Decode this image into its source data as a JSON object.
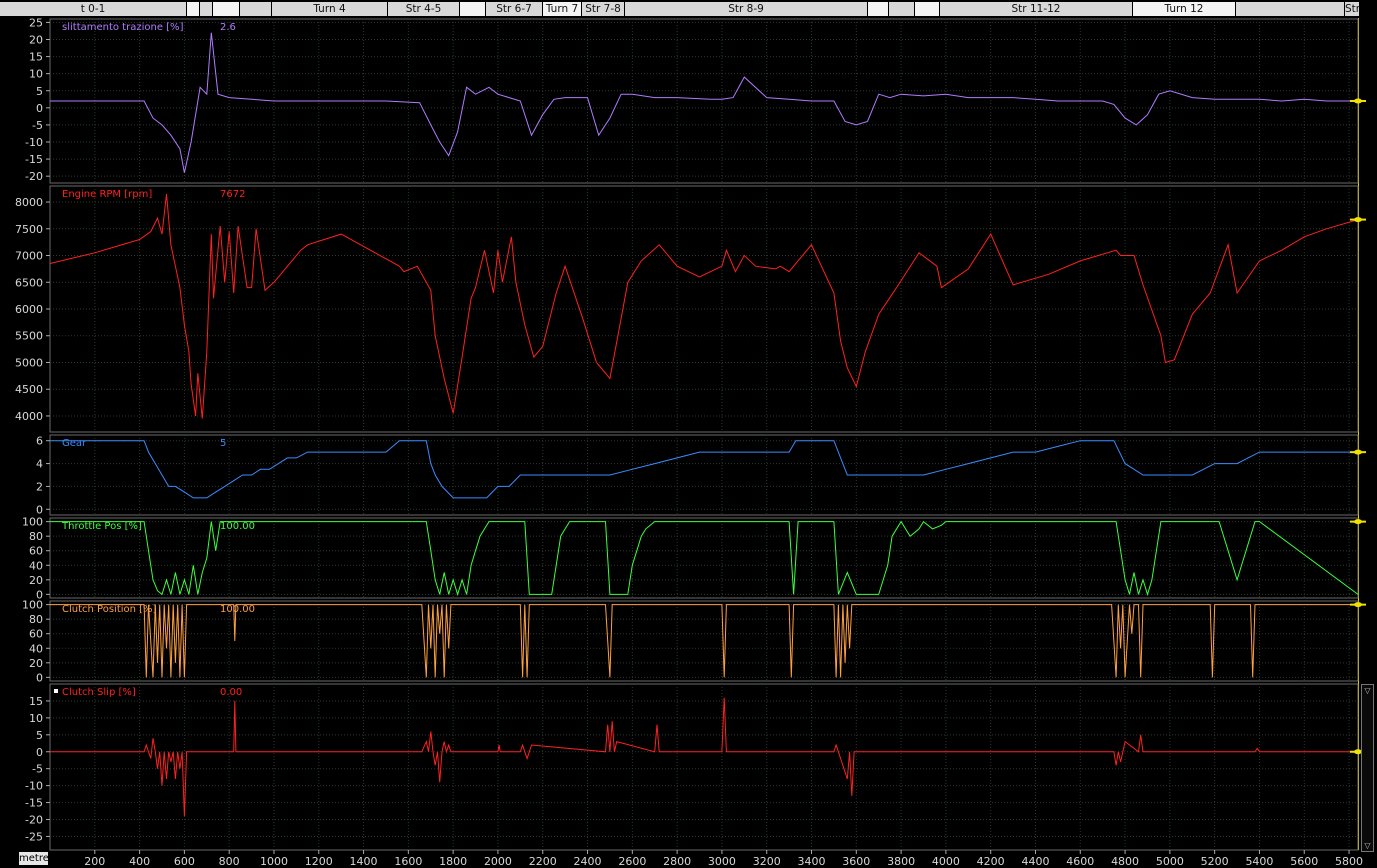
{
  "segments": [
    {
      "label": "t 0-1",
      "start": 0,
      "end": 187,
      "shade": "light"
    },
    {
      "label": "",
      "start": 187,
      "end": 200,
      "shade": "gap"
    },
    {
      "label": "",
      "start": 200,
      "end": 213,
      "shade": "light"
    },
    {
      "label": "",
      "start": 213,
      "end": 240,
      "shade": "gap"
    },
    {
      "label": "",
      "start": 240,
      "end": 272,
      "shade": "light"
    },
    {
      "label": "Turn 4",
      "start": 272,
      "end": 388,
      "shade": "light"
    },
    {
      "label": "Str 4-5",
      "start": 388,
      "end": 460,
      "shade": "light"
    },
    {
      "label": "",
      "start": 460,
      "end": 486,
      "shade": "gap"
    },
    {
      "label": "Str 6-7",
      "start": 486,
      "end": 543,
      "shade": "light"
    },
    {
      "label": "Turn 7",
      "start": 543,
      "end": 582,
      "shade": "gap"
    },
    {
      "label": "Str 7-8",
      "start": 582,
      "end": 625,
      "shade": "light"
    },
    {
      "label": "Str 8-9",
      "start": 625,
      "end": 868,
      "shade": "light"
    },
    {
      "label": "",
      "start": 868,
      "end": 889,
      "shade": "gap"
    },
    {
      "label": "",
      "start": 889,
      "end": 915,
      "shade": "light"
    },
    {
      "label": "",
      "start": 915,
      "end": 940,
      "shade": "gap"
    },
    {
      "label": "Str 11-12",
      "start": 940,
      "end": 1133,
      "shade": "light"
    },
    {
      "label": "Turn 12",
      "start": 1133,
      "end": 1236,
      "shade": "gap"
    },
    {
      "label": "",
      "start": 1236,
      "end": 1345,
      "shade": "light"
    },
    {
      "label": "Str",
      "start": 1345,
      "end": 1360,
      "shade": "light"
    }
  ],
  "x_axis": {
    "unit_label": "metre",
    "range": [
      0,
      5840
    ],
    "ticks": [
      200,
      400,
      600,
      800,
      1000,
      1200,
      1400,
      1600,
      1800,
      2000,
      2200,
      2400,
      2600,
      2800,
      3000,
      3200,
      3400,
      3600,
      3800,
      4000,
      4200,
      4400,
      4600,
      4800,
      5000,
      5200,
      5400,
      5600,
      5800
    ]
  },
  "colors": {
    "background": "#000000",
    "grid": "#2a3a2a",
    "traction": "#b07bff",
    "rpm": "#ff2020",
    "gear": "#3a8cff",
    "throttle": "#3cff3c",
    "clutch_pos": "#ffa040",
    "clutch_slip": "#ff2020",
    "cursor_marker": "#f0e000"
  },
  "chart_data": [
    {
      "type": "line",
      "name": "slittamento trazione [%]",
      "current_value": "2.6",
      "ylim": [
        -22,
        26
      ],
      "yticks": [
        25,
        20,
        15,
        10,
        5,
        0,
        -5,
        -10,
        -15,
        -20
      ],
      "x": [
        0,
        420,
        460,
        500,
        540,
        580,
        600,
        630,
        650,
        670,
        700,
        720,
        750,
        800,
        900,
        1000,
        1200,
        1500,
        1650,
        1700,
        1740,
        1780,
        1820,
        1860,
        1900,
        1960,
        2000,
        2050,
        2100,
        2150,
        2200,
        2250,
        2300,
        2400,
        2450,
        2500,
        2550,
        2600,
        2700,
        2800,
        2950,
        3000,
        3050,
        3100,
        3200,
        3300,
        3400,
        3500,
        3550,
        3600,
        3650,
        3700,
        3750,
        3800,
        3900,
        4000,
        4100,
        4200,
        4300,
        4400,
        4500,
        4600,
        4700,
        4750,
        4800,
        4850,
        4900,
        4950,
        5000,
        5100,
        5200,
        5300,
        5400,
        5500,
        5600,
        5700,
        5840
      ],
      "y": [
        2.0,
        2.0,
        -3.0,
        -5.0,
        -8.0,
        -12.0,
        -19.0,
        -10.0,
        -2.0,
        6.0,
        4.0,
        22.0,
        4.0,
        3.0,
        2.5,
        2.0,
        2.0,
        2.0,
        1.5,
        -5.0,
        -10.0,
        -14.0,
        -7.0,
        6.0,
        4.0,
        6.0,
        4.0,
        3.0,
        2.0,
        -8.0,
        -2.0,
        2.5,
        3.0,
        3.0,
        -8.0,
        -3.0,
        4.0,
        4.0,
        3.0,
        3.0,
        2.5,
        2.5,
        3.0,
        9.0,
        3.0,
        2.5,
        2.0,
        2.0,
        -4.0,
        -5.0,
        -4.0,
        4.0,
        3.0,
        4.0,
        3.5,
        4.0,
        3.0,
        3.0,
        3.0,
        2.5,
        2.0,
        2.0,
        2.0,
        1.0,
        -3.0,
        -5.0,
        -2.0,
        4.0,
        5.0,
        3.0,
        2.5,
        2.5,
        2.5,
        2.0,
        2.5,
        2.0,
        2.0
      ]
    },
    {
      "type": "line",
      "name": "Engine RPM [rpm]",
      "current_value": "7672",
      "ylim": [
        3700,
        8300
      ],
      "yticks": [
        8000,
        7500,
        7000,
        6500,
        6000,
        5500,
        5000,
        4500,
        4000
      ],
      "x": [
        0,
        200,
        400,
        450,
        480,
        500,
        520,
        540,
        560,
        580,
        600,
        620,
        630,
        650,
        660,
        680,
        700,
        720,
        730,
        760,
        780,
        800,
        820,
        840,
        880,
        900,
        920,
        960,
        1000,
        1050,
        1080,
        1120,
        1150,
        1300,
        1560,
        1580,
        1640,
        1700,
        1720,
        1760,
        1800,
        1840,
        1880,
        1900,
        1940,
        1980,
        2000,
        2020,
        2060,
        2080,
        2120,
        2160,
        2200,
        2260,
        2300,
        2380,
        2440,
        2500,
        2540,
        2580,
        2640,
        2720,
        2800,
        2900,
        3000,
        3020,
        3060,
        3100,
        3150,
        3240,
        3260,
        3300,
        3400,
        3500,
        3530,
        3560,
        3600,
        3640,
        3700,
        3780,
        3880,
        3960,
        3980,
        4100,
        4200,
        4300,
        4460,
        4600,
        4760,
        4780,
        4840,
        4880,
        4960,
        4980,
        5020,
        5100,
        5180,
        5260,
        5300,
        5400,
        5500,
        5600,
        5700,
        5840
      ],
      "y": [
        6850,
        7050,
        7300,
        7450,
        7700,
        7400,
        8150,
        7200,
        6800,
        6400,
        5700,
        5200,
        4600,
        4000,
        4800,
        3950,
        5200,
        7400,
        6200,
        7550,
        6500,
        7450,
        6300,
        7550,
        6400,
        6400,
        7500,
        6350,
        6500,
        6750,
        6900,
        7100,
        7200,
        7400,
        6800,
        6700,
        6800,
        6350,
        5500,
        4700,
        4050,
        5100,
        6200,
        6400,
        7100,
        6300,
        7100,
        6500,
        7350,
        6500,
        5700,
        5100,
        5300,
        6300,
        6800,
        5800,
        5000,
        4700,
        5600,
        6500,
        6900,
        7200,
        6800,
        6600,
        6800,
        7100,
        6700,
        7000,
        6800,
        6750,
        6800,
        6700,
        7200,
        6300,
        5400,
        4900,
        4550,
        5200,
        5900,
        6400,
        7050,
        6800,
        6400,
        6750,
        7400,
        6450,
        6650,
        6900,
        7100,
        7000,
        7000,
        6450,
        5500,
        5000,
        5050,
        5900,
        6300,
        7200,
        6300,
        6900,
        7100,
        7350,
        7500,
        7672
      ]
    },
    {
      "type": "line",
      "name": "Gear",
      "current_value": "5",
      "ylim": [
        -0.5,
        6.5
      ],
      "yticks": [
        6,
        4,
        2,
        0
      ],
      "x": [
        0,
        420,
        440,
        470,
        500,
        530,
        560,
        600,
        640,
        700,
        740,
        780,
        820,
        860,
        900,
        940,
        980,
        1020,
        1060,
        1100,
        1150,
        1200,
        1300,
        1400,
        1500,
        1560,
        1580,
        1680,
        1700,
        1720,
        1750,
        1800,
        1850,
        1900,
        1950,
        2000,
        2050,
        2100,
        2150,
        2200,
        2300,
        2400,
        2500,
        2600,
        2700,
        2800,
        2900,
        3000,
        3050,
        3100,
        3200,
        3300,
        3330,
        3400,
        3500,
        3560,
        3620,
        3700,
        3800,
        3900,
        4000,
        4100,
        4200,
        4300,
        4400,
        4500,
        4600,
        4700,
        4750,
        4800,
        4880,
        4900,
        5000,
        5100,
        5200,
        5300,
        5400,
        5500,
        5600,
        5700,
        5840
      ],
      "y": [
        6,
        6,
        5,
        4,
        3,
        2,
        2,
        1.5,
        1,
        1,
        1.5,
        2,
        2.5,
        3,
        3,
        3.5,
        3.5,
        4,
        4.5,
        4.5,
        5,
        5,
        5,
        5,
        5,
        6,
        6,
        6,
        4,
        3,
        2,
        1,
        1,
        1,
        1,
        2,
        2,
        3,
        3,
        3,
        3,
        3,
        3,
        3.5,
        4,
        4.5,
        5,
        5,
        5,
        5,
        5,
        5,
        6,
        6,
        6,
        3,
        3,
        3,
        3,
        3,
        3.5,
        4,
        4.5,
        5,
        5,
        5.5,
        6,
        6,
        6,
        4,
        3,
        3,
        3,
        3,
        4,
        4,
        5,
        5,
        5,
        5,
        5
      ]
    },
    {
      "type": "line",
      "name": "Throttle Pos [%]",
      "current_value": "100.00",
      "ylim": [
        -5,
        105
      ],
      "yticks": [
        100,
        80,
        60,
        40,
        20,
        0
      ],
      "x": [
        0,
        420,
        440,
        460,
        480,
        500,
        520,
        540,
        560,
        580,
        600,
        620,
        640,
        660,
        680,
        700,
        720,
        740,
        760,
        780,
        800,
        820,
        840,
        1000,
        1200,
        1400,
        1600,
        1680,
        1700,
        1720,
        1740,
        1760,
        1780,
        1800,
        1820,
        1840,
        1860,
        1880,
        1900,
        1920,
        1940,
        1960,
        1980,
        2000,
        2100,
        2120,
        2140,
        2160,
        2200,
        2240,
        2260,
        2280,
        2300,
        2320,
        2360,
        2400,
        2480,
        2500,
        2520,
        2560,
        2580,
        2600,
        2640,
        2660,
        2700,
        2800,
        2900,
        3000,
        3300,
        3320,
        3340,
        3400,
        3500,
        3520,
        3560,
        3600,
        3640,
        3680,
        3700,
        3740,
        3760,
        3800,
        3840,
        3880,
        3900,
        3940,
        3980,
        4000,
        4200,
        4400,
        4600,
        4700,
        4760,
        4780,
        4800,
        4820,
        4840,
        4860,
        4880,
        4900,
        4920,
        4940,
        4960,
        4980,
        5000,
        5100,
        5200,
        5220,
        5300,
        5380,
        5400,
        5840
      ],
      "y": [
        100,
        100,
        60,
        20,
        5,
        0,
        20,
        0,
        30,
        0,
        20,
        0,
        40,
        0,
        30,
        50,
        100,
        60,
        100,
        100,
        100,
        100,
        100,
        100,
        100,
        100,
        100,
        100,
        60,
        20,
        0,
        30,
        0,
        20,
        0,
        20,
        0,
        40,
        60,
        80,
        90,
        100,
        100,
        100,
        100,
        100,
        0,
        0,
        0,
        0,
        40,
        80,
        90,
        100,
        100,
        100,
        100,
        0,
        0,
        0,
        0,
        40,
        80,
        90,
        100,
        100,
        100,
        100,
        100,
        0,
        100,
        100,
        100,
        0,
        30,
        0,
        0,
        0,
        0,
        40,
        80,
        100,
        80,
        90,
        100,
        90,
        95,
        100,
        100,
        100,
        100,
        100,
        100,
        60,
        20,
        0,
        30,
        0,
        20,
        0,
        20,
        60,
        100,
        100,
        100,
        100,
        100,
        100,
        20,
        100,
        100,
        0,
        100,
        100
      ]
    },
    {
      "type": "line",
      "name": "Clutch Position [%]",
      "current_value": "100.00",
      "ylim": [
        -5,
        105
      ],
      "yticks": [
        100,
        80,
        60,
        40,
        20,
        0
      ],
      "x": [
        0,
        420,
        430,
        440,
        460,
        470,
        480,
        490,
        500,
        510,
        520,
        530,
        540,
        550,
        560,
        570,
        580,
        590,
        600,
        610,
        620,
        820,
        825,
        830,
        1660,
        1680,
        1690,
        1700,
        1710,
        1720,
        1730,
        1740,
        1750,
        1760,
        1770,
        1780,
        1790,
        2100,
        2110,
        2120,
        2130,
        2140,
        2150,
        2480,
        2500,
        2510,
        3000,
        3010,
        3020,
        3300,
        3310,
        3320,
        3500,
        3510,
        3520,
        3530,
        3540,
        3550,
        3560,
        3570,
        3580,
        4740,
        4760,
        4770,
        4780,
        4790,
        4800,
        4820,
        4830,
        4840,
        4860,
        4870,
        4880,
        5180,
        5190,
        5200,
        5360,
        5370,
        5380,
        5840
      ],
      "y": [
        100,
        100,
        0,
        100,
        0,
        100,
        20,
        100,
        0,
        100,
        40,
        100,
        0,
        100,
        20,
        100,
        0,
        100,
        0,
        100,
        100,
        100,
        50,
        100,
        100,
        0,
        100,
        40,
        100,
        0,
        100,
        60,
        100,
        0,
        100,
        40,
        100,
        100,
        0,
        100,
        0,
        100,
        100,
        100,
        0,
        100,
        100,
        0,
        100,
        100,
        0,
        100,
        100,
        0,
        100,
        0,
        100,
        20,
        100,
        40,
        100,
        100,
        0,
        100,
        40,
        100,
        0,
        100,
        60,
        100,
        100,
        0,
        100,
        100,
        0,
        100,
        100,
        0,
        100,
        100
      ]
    },
    {
      "type": "line",
      "name": "Clutch Slip [%]",
      "current_value": "0.00",
      "ylim": [
        -29,
        20
      ],
      "yticks": [
        15,
        10,
        5,
        0,
        -5,
        -10,
        -15,
        -20,
        -25
      ],
      "x": [
        0,
        420,
        430,
        440,
        450,
        460,
        470,
        480,
        490,
        500,
        510,
        520,
        530,
        540,
        550,
        560,
        570,
        580,
        590,
        600,
        610,
        620,
        820,
        825,
        830,
        1660,
        1680,
        1690,
        1700,
        1710,
        1720,
        1730,
        1740,
        1750,
        1760,
        1770,
        1780,
        1790,
        2000,
        2005,
        2010,
        2100,
        2110,
        2120,
        2130,
        2140,
        2150,
        2480,
        2490,
        2500,
        2510,
        2520,
        2530,
        2700,
        2710,
        2720,
        3000,
        3010,
        3020,
        3500,
        3510,
        3520,
        3560,
        3570,
        3580,
        3590,
        3600,
        4750,
        4760,
        4770,
        4780,
        4790,
        4800,
        4860,
        4870,
        4880,
        5380,
        5390,
        5400,
        5840
      ],
      "y": [
        0,
        0,
        2,
        0,
        -2,
        4,
        0,
        -5,
        0,
        -10,
        0,
        -8,
        0,
        -3,
        0,
        -8,
        0,
        -5,
        0,
        -19,
        0,
        0,
        0,
        15,
        0,
        0,
        3,
        0,
        6,
        0,
        -4,
        0,
        -9,
        0,
        3,
        0,
        2,
        0,
        0,
        2,
        0,
        0,
        2,
        0,
        -2,
        0,
        2,
        0,
        8,
        0,
        9,
        0,
        3,
        0,
        8,
        0,
        0,
        16,
        0,
        0,
        2,
        0,
        -8,
        0,
        -13,
        0,
        0,
        0,
        -4,
        0,
        -3,
        0,
        3,
        0,
        5,
        0,
        0,
        1,
        0,
        0
      ]
    }
  ]
}
